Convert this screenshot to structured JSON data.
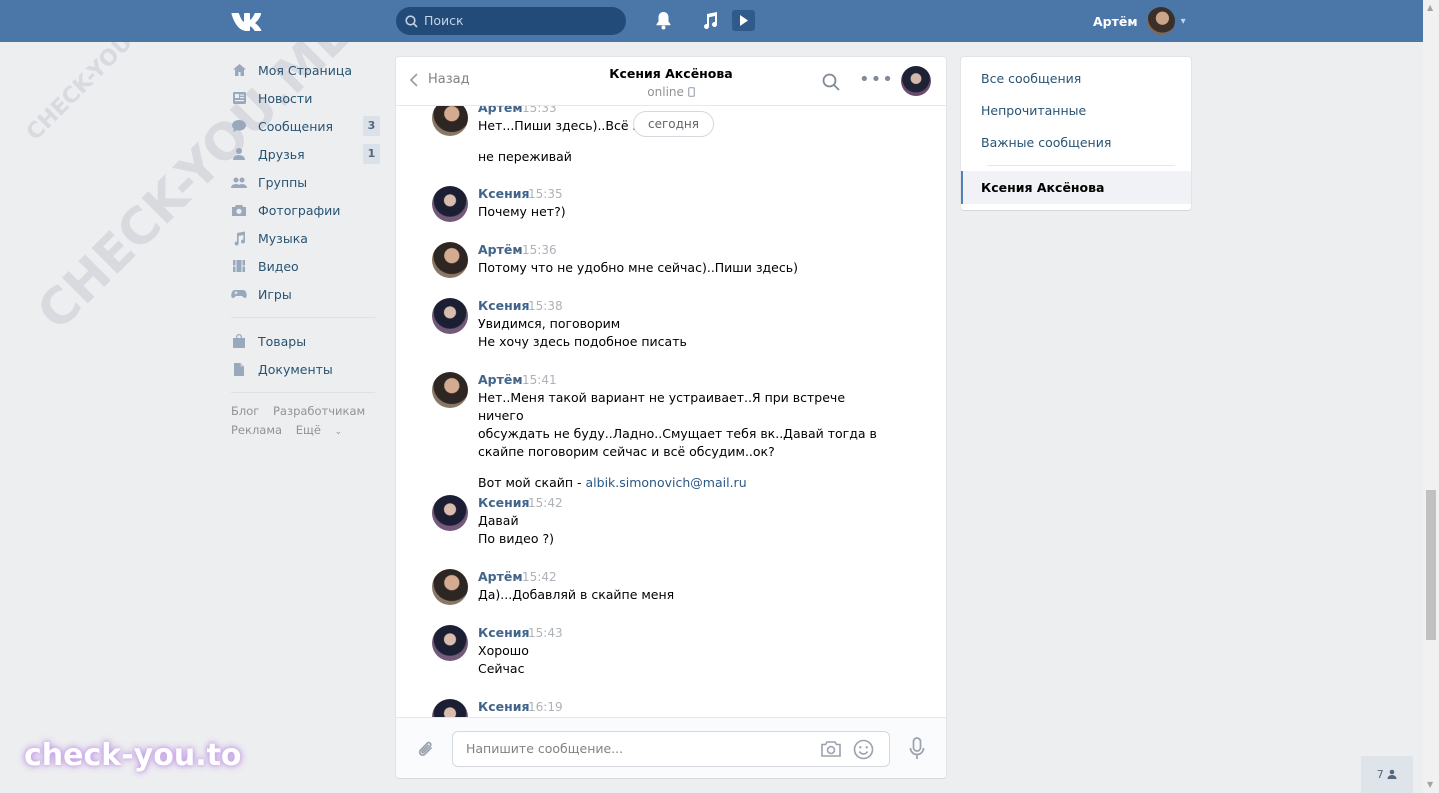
{
  "topbar": {
    "logo_text": "VK",
    "search_placeholder": "Поиск",
    "user_name": "Артём"
  },
  "sidebar": {
    "items": [
      {
        "label": "Моя Страница",
        "icon": "home-icon",
        "badge": ""
      },
      {
        "label": "Новости",
        "icon": "news-icon",
        "badge": ""
      },
      {
        "label": "Сообщения",
        "icon": "messages-icon",
        "badge": "3"
      },
      {
        "label": "Друзья",
        "icon": "friends-icon",
        "badge": "1"
      },
      {
        "label": "Группы",
        "icon": "groups-icon",
        "badge": ""
      },
      {
        "label": "Фотографии",
        "icon": "camera-icon",
        "badge": ""
      },
      {
        "label": "Музыка",
        "icon": "music-icon",
        "badge": ""
      },
      {
        "label": "Видео",
        "icon": "video-icon",
        "badge": ""
      },
      {
        "label": "Игры",
        "icon": "gamepad-icon",
        "badge": ""
      }
    ],
    "items2": [
      {
        "label": "Товары",
        "icon": "bag-icon"
      },
      {
        "label": "Документы",
        "icon": "document-icon"
      }
    ],
    "footer": {
      "blog": "Блог",
      "developers": "Разработчикам",
      "ads": "Реклама",
      "more": "Ещё"
    }
  },
  "chat": {
    "back_label": "Назад",
    "peer_name": "Ксения Аксёнова",
    "peer_status": "online",
    "today_label": "сегодня",
    "input_placeholder": "Напишите сообщение...",
    "messages": [
      {
        "author": "Артём",
        "time": "15:33",
        "avatar": "a",
        "lines": [
          "Нет...Пиши здесь)..Всё ме",
          "",
          "не переживай"
        ]
      },
      {
        "author": "Ксения",
        "time": "15:35",
        "avatar": "k",
        "lines": [
          "Почему нет?)"
        ]
      },
      {
        "author": "Артём",
        "time": "15:36",
        "avatar": "a",
        "lines": [
          "Потому что не удобно мне сейчас)..Пиши здесь)"
        ]
      },
      {
        "author": "Ксения",
        "time": "15:38",
        "avatar": "k",
        "lines": [
          "Увидимся, поговорим",
          "Не хочу здесь подобное писать"
        ]
      },
      {
        "author": "Артём",
        "time": "15:41",
        "avatar": "a",
        "lines": [
          "Нет..Меня такой вариант не устраивает..Я при встрече ничего",
          "обсуждать не буду..Ладно..Смущает тебя вк..Давай тогда в",
          "скайпе поговорим сейчас и всё обсудим..ок?"
        ],
        "extra_prefix": "Вот мой скайп - ",
        "extra_link": "albik.simonovich@mail.ru"
      },
      {
        "author": "Ксения",
        "time": "15:42",
        "avatar": "k",
        "lines": [
          "Давай",
          "По видео ?)"
        ]
      },
      {
        "author": "Артём",
        "time": "15:42",
        "avatar": "a",
        "lines": [
          "Да)...Добавляй в скайпе меня"
        ]
      },
      {
        "author": "Ксения",
        "time": "15:43",
        "avatar": "k",
        "lines": [
          "Хорошо",
          "Сейчас"
        ]
      },
      {
        "author": "Ксения",
        "time": "16:19",
        "avatar": "k",
        "lines": []
      }
    ]
  },
  "right_menu": {
    "all": "Все сообщения",
    "unread": "Непрочитанные",
    "important": "Важные сообщения",
    "active_chat": "Ксения Аксёнова"
  },
  "pager": {
    "count": "7"
  },
  "watermarks": {
    "small": "CHECK-YOU.ME",
    "big": "CHECK-YOU.ME",
    "brand": "check-you.to"
  },
  "colors": {
    "header": "#4a76a8",
    "link": "#2a5885",
    "author": "#42648b",
    "background": "#edeef0"
  }
}
